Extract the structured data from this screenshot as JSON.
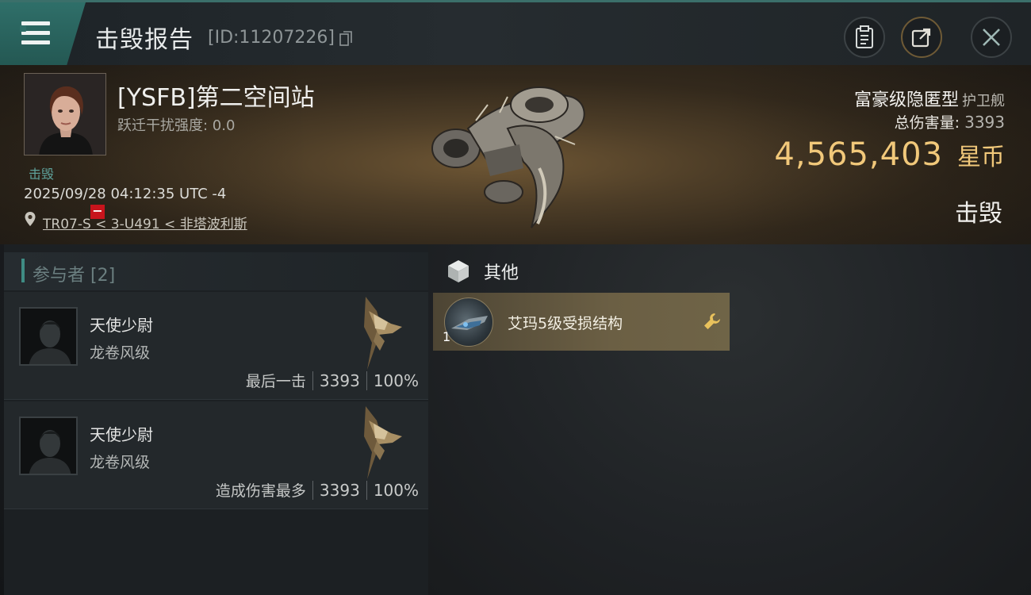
{
  "header": {
    "title": "击毁报告",
    "report_id": "[ID:11207226]"
  },
  "victim": {
    "name": "[YSFB]第二空间站",
    "warp_disruption": "跃迁干扰强度: 0.0",
    "status": "击毁",
    "timestamp": "2025/09/28 04:12:35 UTC -4",
    "location": "TR07-S < 3-U491 < 非塔波利斯",
    "ship_name": "富豪级隐匿型",
    "ship_class": "护卫舰",
    "damage_label": "总伤害量:",
    "damage_value": "3393",
    "isk_value": "4,565,403",
    "isk_unit": "星币",
    "kill_type": "击毁"
  },
  "participants": {
    "label": "参与者 [2]",
    "items": [
      {
        "name": "天使少尉",
        "ship": "龙卷风级",
        "tag": "最后一击",
        "damage": "3393",
        "percent": "100%"
      },
      {
        "name": "天使少尉",
        "ship": "龙卷风级",
        "tag": "造成伤害最多",
        "damage": "3393",
        "percent": "100%"
      }
    ]
  },
  "other": {
    "label": "其他",
    "items": [
      {
        "name": "艾玛5级受损结构",
        "quantity": "1"
      }
    ]
  },
  "icons": {
    "menu": "menu-icon",
    "copy": "copy-icon",
    "clipboard": "clipboard-icon",
    "share": "share-icon",
    "close": "close-icon",
    "location": "location-pin-icon",
    "cube": "cube-icon",
    "wrench": "wrench-icon"
  },
  "colors": {
    "accent_teal": "#2f6f69",
    "isk_gold": "#f1c87a",
    "kill_badge_red": "#c8141c",
    "item_bg": "#6b5f44"
  }
}
